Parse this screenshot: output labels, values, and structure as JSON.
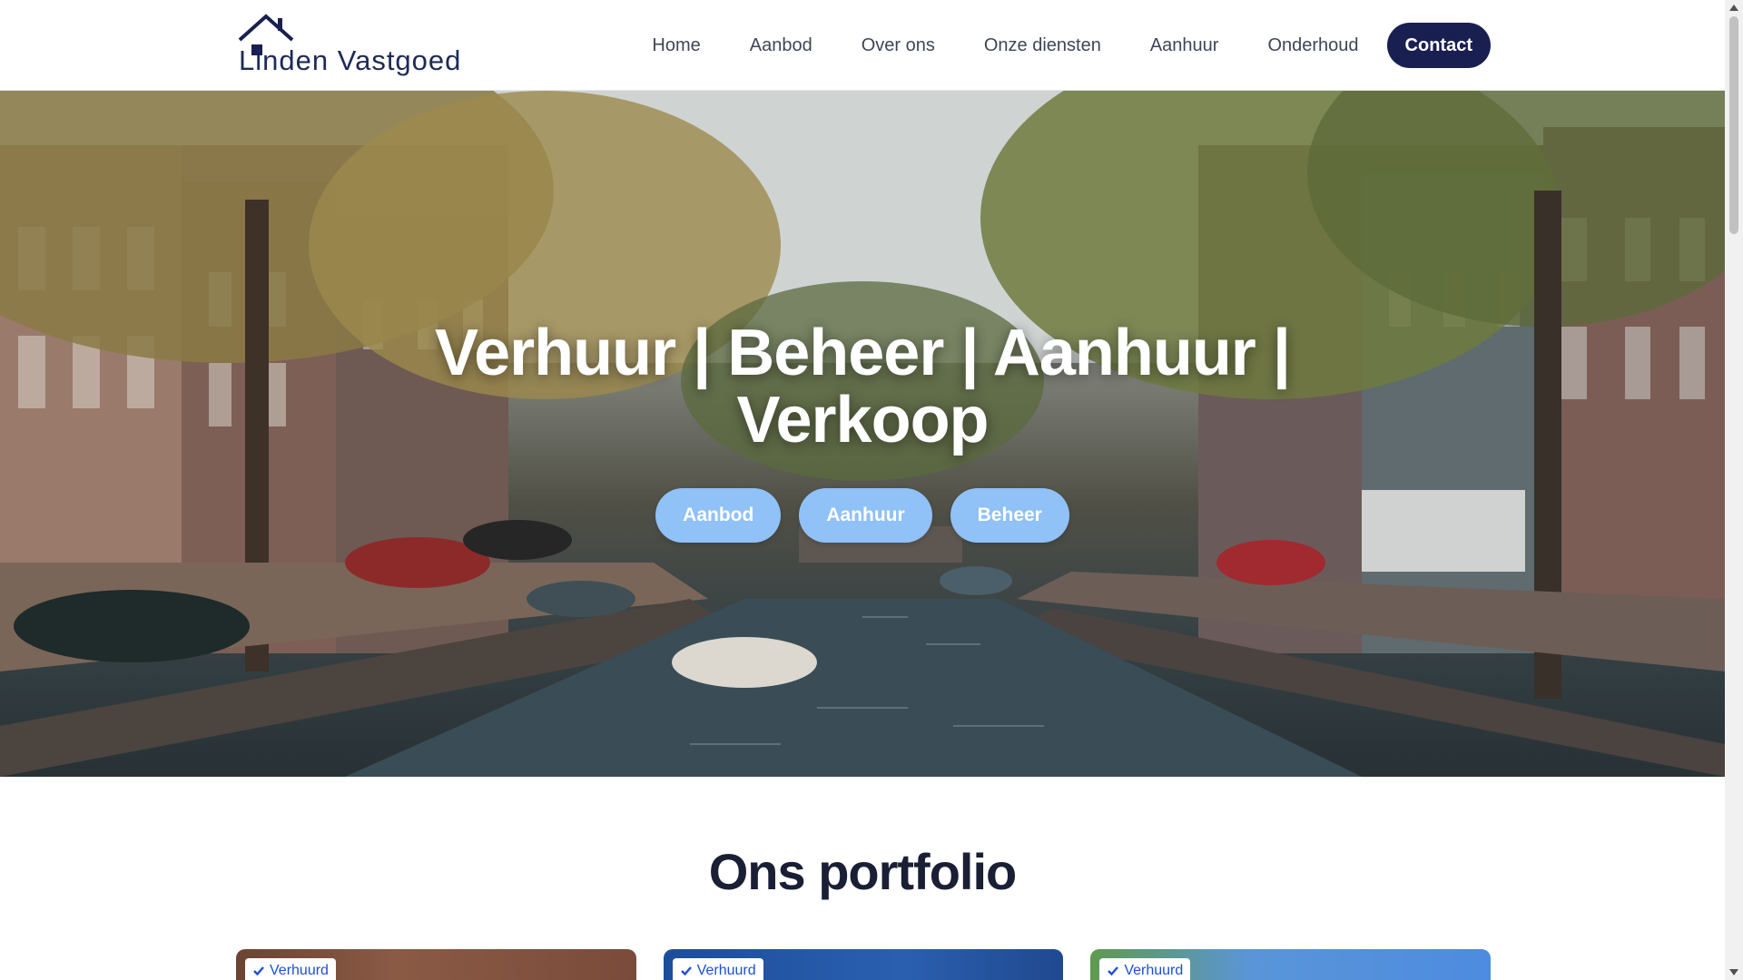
{
  "header": {
    "logo_text": "Linden Vastgoed",
    "nav": [
      "Home",
      "Aanbod",
      "Over ons",
      "Onze diensten",
      "Aanhuur",
      "Onderhoud"
    ],
    "contact_label": "Contact"
  },
  "hero": {
    "title": "Verhuur | Beheer | Aanhuur | Verkoop",
    "buttons": [
      "Aanbod",
      "Aanhuur",
      "Beheer"
    ]
  },
  "portfolio": {
    "title": "Ons portfolio",
    "cards": [
      {
        "badge": "Verhuurd"
      },
      {
        "badge": "Verhuurd"
      },
      {
        "badge": "Verhuurd"
      }
    ]
  },
  "colors": {
    "brand_navy": "#1a1f52",
    "hero_button": "#90c1f7",
    "badge_text": "#1d4ed8"
  }
}
